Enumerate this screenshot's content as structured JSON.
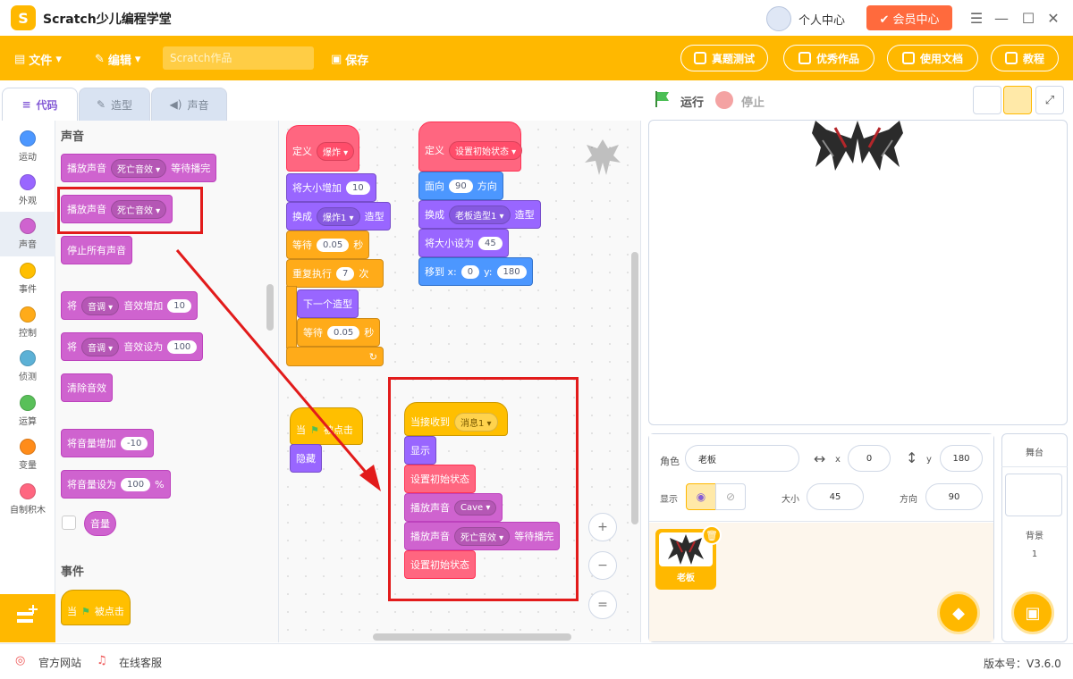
{
  "app": {
    "logo": "S",
    "title": "Scratch少儿编程学堂",
    "user_center": "个人中心",
    "member": "✔ 会员中心"
  },
  "window_controls": {
    "menu": "☰",
    "minimize": "—",
    "maximize": "☐",
    "close": "✕"
  },
  "toolbar": {
    "file": "文件",
    "edit": "编辑",
    "project_placeholder": "Scratch作品",
    "save": "保存",
    "exam": "真题测试",
    "showcase": "优秀作品",
    "docs": "使用文档",
    "tutorial": "教程"
  },
  "tabs": {
    "code": "代码",
    "costume": "造型",
    "sound": "声音"
  },
  "run": {
    "run": "运行",
    "stop": "停止"
  },
  "categories": [
    {
      "label": "运动",
      "color": "#4c97ff"
    },
    {
      "label": "外观",
      "color": "#9966ff"
    },
    {
      "label": "声音",
      "color": "#cf63cf"
    },
    {
      "label": "事件",
      "color": "#ffbf00"
    },
    {
      "label": "控制",
      "color": "#ffab19"
    },
    {
      "label": "侦测",
      "color": "#5cb1d6"
    },
    {
      "label": "运算",
      "color": "#59c059"
    },
    {
      "label": "变量",
      "color": "#ff8c1a"
    },
    {
      "label": "自制积木",
      "color": "#ff6680"
    }
  ],
  "palette": {
    "sound_header": "声音",
    "play_until_done": {
      "text": "播放声音",
      "sound": "死亡音效",
      "suffix": "等待播完"
    },
    "start_sound": {
      "text": "播放声音",
      "sound": "死亡音效"
    },
    "stop_all": "停止所有声音",
    "change_effect": {
      "prefix": "将",
      "effect": "音调",
      "text": "音效增加",
      "value": "10"
    },
    "set_effect": {
      "prefix": "将",
      "effect": "音调",
      "text": "音效设为",
      "value": "100"
    },
    "clear_effects": "清除音效",
    "change_volume": {
      "text": "将音量增加",
      "value": "-10"
    },
    "set_volume": {
      "text": "将音量设为",
      "value": "100",
      "suffix": "%"
    },
    "volume_reporter": "音量",
    "events_header": "事件",
    "when_flag": {
      "prefix": "当",
      "suffix": "被点击"
    }
  },
  "script1": {
    "define": "定义",
    "name": "爆炸",
    "change_size": "将大小增加",
    "change_size_val": "10",
    "switch": "换成",
    "costume": "爆炸1",
    "costume_suffix": "造型",
    "wait": "等待",
    "wait_val": "0.05",
    "sec": "秒",
    "repeat": "重复执行",
    "repeat_val": "7",
    "times": "次",
    "next": "下一个造型",
    "wait2_val": "0.05"
  },
  "script2": {
    "define": "定义",
    "name": "设置初始状态",
    "point": "面向",
    "point_val": "90",
    "direction": "方向",
    "switch": "换成",
    "costume": "老板造型1",
    "costume_suffix": "造型",
    "set_size": "将大小设为",
    "size_val": "45",
    "goto": "移到 x:",
    "x": "0",
    "ylabel": "y:",
    "y": "180"
  },
  "script3": {
    "when": "当",
    "clicked": "被点击",
    "hide": "隐藏"
  },
  "script4": {
    "receive": "当接收到",
    "msg": "消息1",
    "show": "显示",
    "call1": "设置初始状态",
    "play": "播放声音",
    "sound": "Cave",
    "play2": "播放声音",
    "sound2": "死亡音效",
    "until": "等待播完",
    "call2": "设置初始状态"
  },
  "zoom": {
    "in": "+",
    "out": "−",
    "reset": "="
  },
  "sprite": {
    "role_label": "角色",
    "name": "老板",
    "x_label": "x",
    "x": "0",
    "y_label": "y",
    "y": "180",
    "show_label": "显示",
    "size_label": "大小",
    "size": "45",
    "dir_label": "方向",
    "dir": "90",
    "card_name": "老板"
  },
  "stage_panel": {
    "title": "舞台",
    "backdrop_label": "背景",
    "backdrop_count": "1"
  },
  "status": {
    "website": "官方网站",
    "support": "在线客服",
    "version": "版本号：V3.6.0"
  }
}
